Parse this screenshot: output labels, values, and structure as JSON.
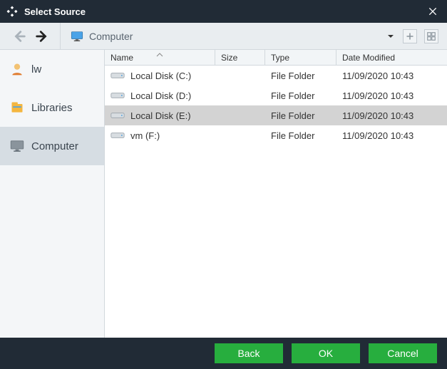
{
  "title": "Select Source",
  "breadcrumb": {
    "label": "Computer"
  },
  "sidebar": {
    "items": [
      {
        "label": "lw",
        "icon": "user",
        "selected": false
      },
      {
        "label": "Libraries",
        "icon": "libraries",
        "selected": false
      },
      {
        "label": "Computer",
        "icon": "monitor",
        "selected": true
      }
    ]
  },
  "columns": {
    "name": "Name",
    "size": "Size",
    "type": "Type",
    "date": "Date Modified"
  },
  "rows": [
    {
      "name": "Local Disk (C:)",
      "size": "",
      "type": "File Folder",
      "date": "11/09/2020 10:43",
      "selected": false
    },
    {
      "name": "Local Disk (D:)",
      "size": "",
      "type": "File Folder",
      "date": "11/09/2020 10:43",
      "selected": false
    },
    {
      "name": "Local Disk (E:)",
      "size": "",
      "type": "File Folder",
      "date": "11/09/2020 10:43",
      "selected": true
    },
    {
      "name": "vm (F:)",
      "size": "",
      "type": "File Folder",
      "date": "11/09/2020 10:43",
      "selected": false
    }
  ],
  "footer": {
    "back": "Back",
    "ok": "OK",
    "cancel": "Cancel"
  }
}
